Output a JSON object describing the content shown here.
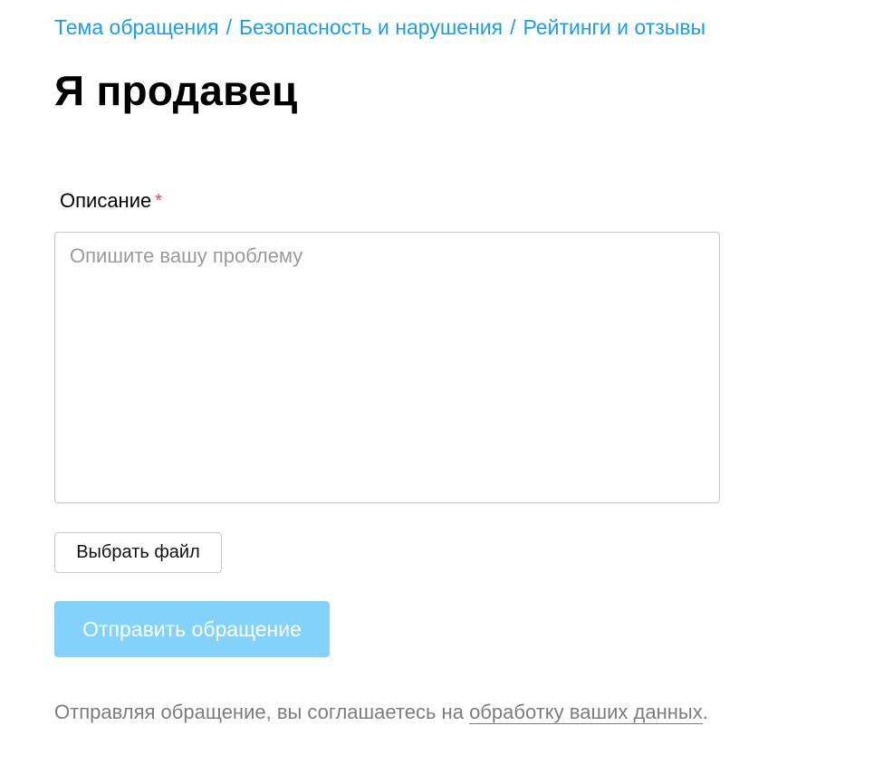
{
  "breadcrumb": {
    "items": [
      {
        "label": "Тема обращения"
      },
      {
        "label": "Безопасность и нарушения"
      },
      {
        "label": "Рейтинги и отзывы"
      }
    ],
    "separator": "/"
  },
  "page": {
    "title": "Я продавец"
  },
  "form": {
    "description_label": "Описание",
    "required_mark": "*",
    "description_value": "",
    "description_placeholder": "Опишите вашу проблему",
    "file_button_label": "Выбрать файл",
    "submit_label": "Отправить обращение"
  },
  "agreement": {
    "text_before": "Отправляя обращение, вы соглашаетесь на ",
    "link_label": "обработку ваших данных",
    "text_after": "."
  },
  "colors": {
    "link": "#1a9ee8",
    "submit_disabled": "#82d2fb",
    "required": "#e5484d",
    "muted_text": "#7c7c7c"
  }
}
